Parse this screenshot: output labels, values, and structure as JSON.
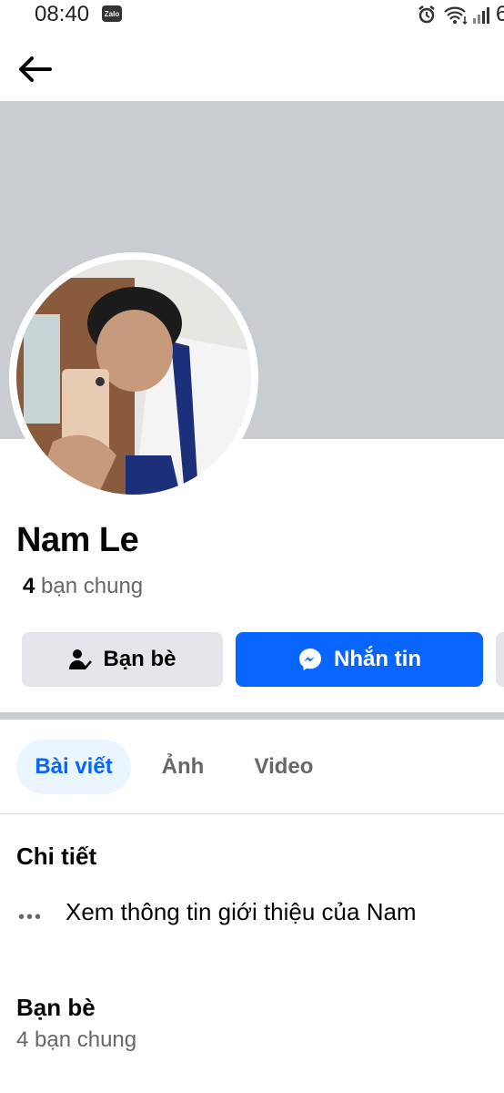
{
  "status_bar": {
    "time": "08:40",
    "zalo_badge": "Zalo",
    "battery_partial": "6"
  },
  "profile": {
    "name": "Nam Le",
    "mutual_count": "4",
    "mutual_label": "bạn chung"
  },
  "actions": {
    "friends_label": "Bạn bè",
    "message_label": "Nhắn tin"
  },
  "tabs": [
    {
      "label": "Bài viết",
      "active": true
    },
    {
      "label": "Ảnh",
      "active": false
    },
    {
      "label": "Video",
      "active": false
    }
  ],
  "details": {
    "title": "Chi tiết",
    "intro_link": "Xem thông tin giới thiệu của Nam"
  },
  "friends_section": {
    "title": "Bạn bè",
    "mutual_text": "4 bạn chung"
  },
  "colors": {
    "accent": "#0866ff",
    "cover": "#c9ccd1",
    "secondary_button": "#e4e6eb",
    "active_tab_bg": "#ebf5ff"
  }
}
